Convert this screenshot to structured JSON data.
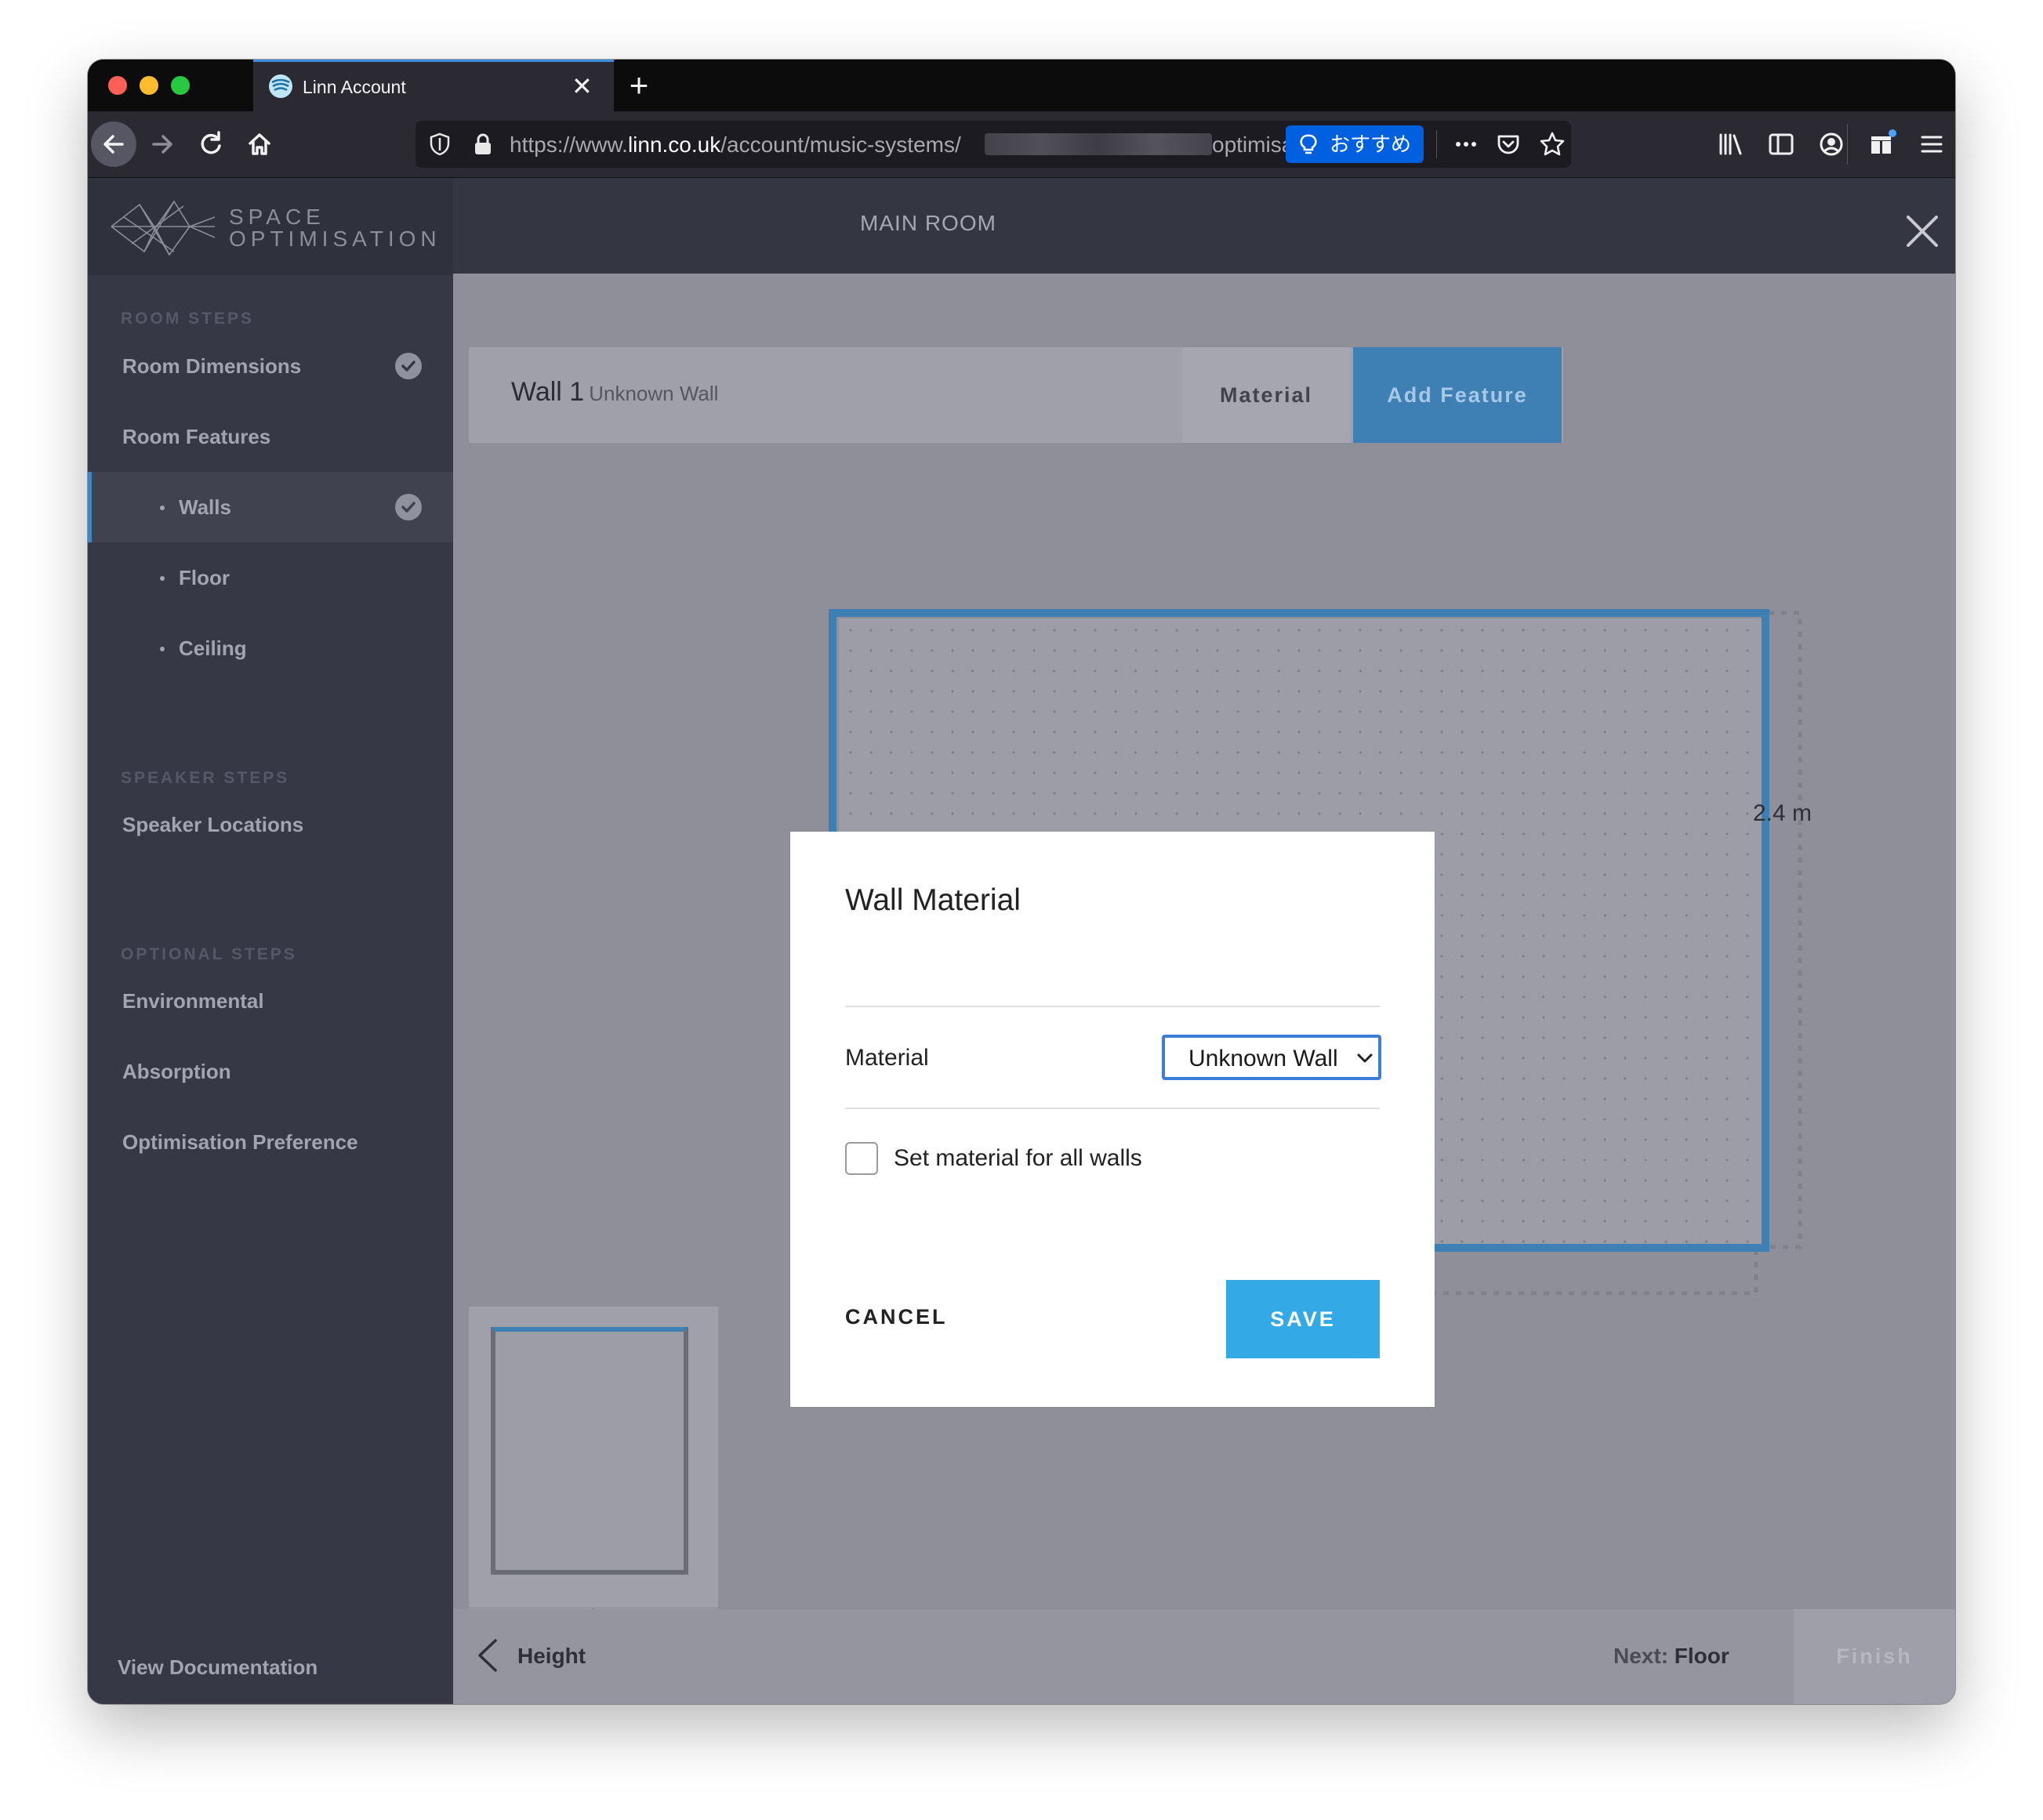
{
  "browser": {
    "tab_title": "Linn Account",
    "url_prefix": "https://www.",
    "url_host": "linn.co.uk",
    "url_path": "/account/music-systems/",
    "url_suffix": "optimisa",
    "recommendation_label": "おすすめ"
  },
  "brand": {
    "logo_line1": "SPACE",
    "logo_line2": "OPTIMISATION"
  },
  "sidebar": {
    "room_steps_label": "ROOM STEPS",
    "room_dimensions": "Room Dimensions",
    "room_features": "Room Features",
    "walls": "Walls",
    "floor": "Floor",
    "ceiling": "Ceiling",
    "speaker_steps_label": "SPEAKER STEPS",
    "speaker_locations": "Speaker Locations",
    "optional_steps_label": "OPTIONAL STEPS",
    "environmental": "Environmental",
    "absorption": "Absorption",
    "optimisation_preference": "Optimisation Preference",
    "view_documentation": "View Documentation"
  },
  "header": {
    "room_title": "MAIN ROOM"
  },
  "wall_toolbar": {
    "wall_name": "Wall 1",
    "wall_material": "Unknown Wall",
    "material_button": "Material",
    "add_feature_button": "Add Feature"
  },
  "canvas": {
    "dimension_label": "2.4 m"
  },
  "footer": {
    "prev_label": "Height",
    "next_prefix": "Next:",
    "next_label": "Floor",
    "finish_label": "Finish"
  },
  "modal": {
    "title": "Wall Material",
    "material_label": "Material",
    "material_value": "Unknown Wall",
    "all_walls_label": "Set material for all walls",
    "all_walls_checked": false,
    "cancel_label": "CANCEL",
    "save_label": "SAVE"
  },
  "colors": {
    "accent_blue": "#3e7fb4",
    "save_blue": "#33a9e6",
    "sidebar_bg": "#363845"
  }
}
